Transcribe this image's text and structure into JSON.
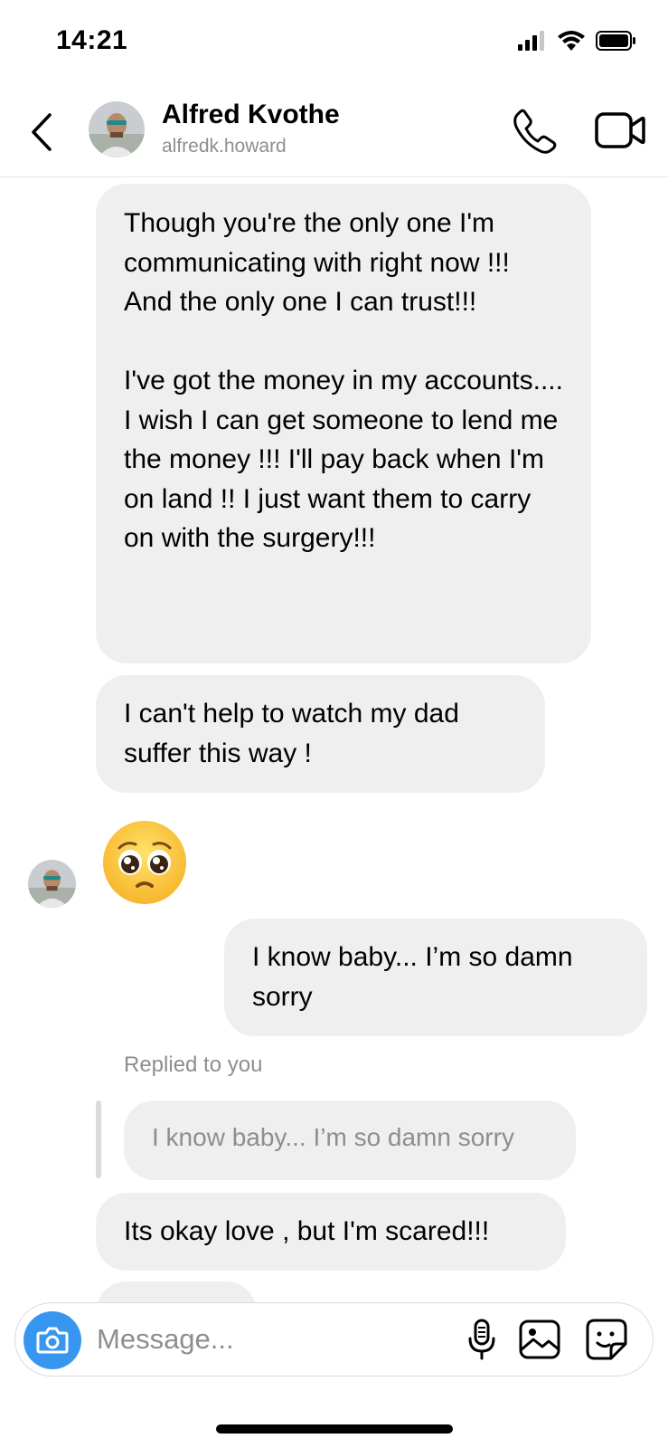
{
  "status_bar": {
    "time": "14:21"
  },
  "header": {
    "name": "Alfred Kvothe",
    "username": "alfredk.howard"
  },
  "messages": {
    "m1_para1": "Though you're the only one I'm communicating with right now !!! And the only one I can trust!!!",
    "m1_para2": "I've got the money in my accounts.... I wish I can get someone to lend me the money !!! I'll pay back when I'm on land !! I just want them to carry on with the surgery!!!",
    "m2": "I can't help to watch my dad suffer this way !",
    "m3_emoji": "🥺",
    "m4": "I know baby... I’m so damn sorry",
    "reply_label": "Replied to you",
    "reply_quote": "I know baby... I’m so damn sorry",
    "m5": "Its okay love , but I'm scared!!!"
  },
  "composer": {
    "placeholder": "Message..."
  },
  "colors": {
    "accent": "#3797f0",
    "bubble": "#efefef",
    "secondary_text": "#8e8e8e"
  },
  "icons": [
    "back-icon",
    "call-icon",
    "video-call-icon",
    "camera-icon",
    "microphone-icon",
    "gallery-icon",
    "sticker-icon",
    "signal-icon",
    "wifi-icon",
    "battery-icon"
  ]
}
